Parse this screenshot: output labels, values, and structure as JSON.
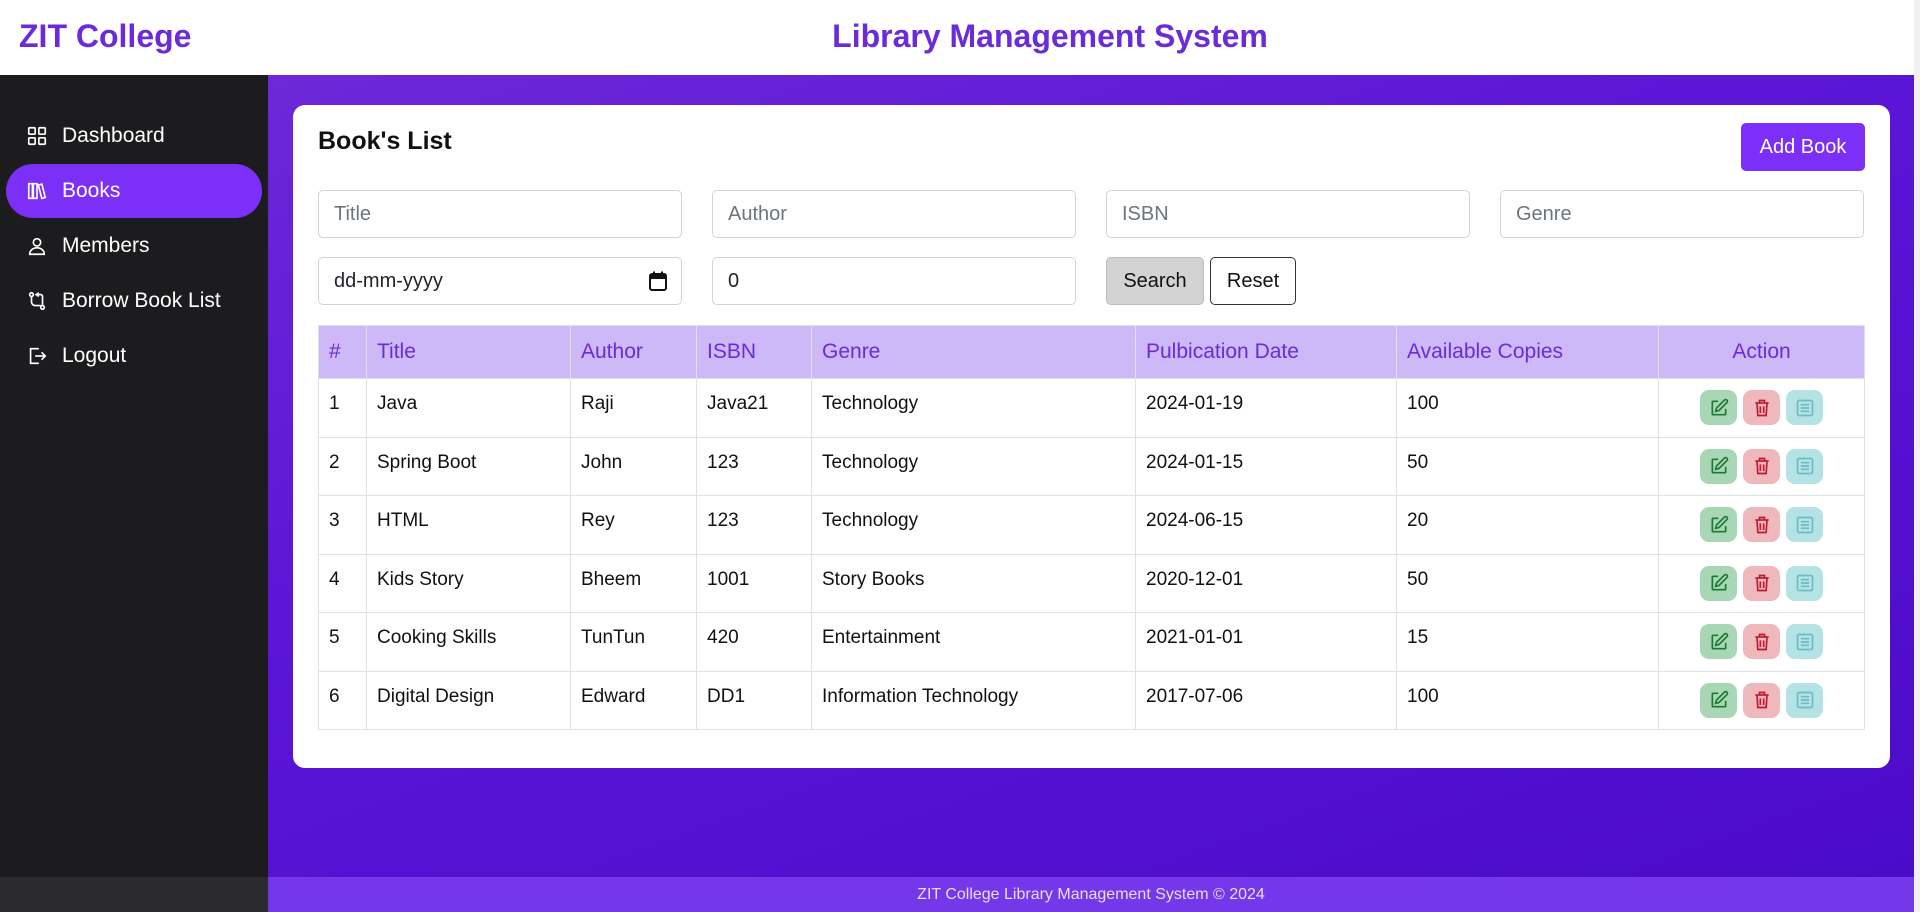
{
  "header": {
    "brand": "ZIT College",
    "title": "Library Management System"
  },
  "sidebar": {
    "items": [
      {
        "label": "Dashboard",
        "icon": "dashboard-icon",
        "active": false
      },
      {
        "label": "Books",
        "icon": "books-icon",
        "active": true
      },
      {
        "label": "Members",
        "icon": "user-icon",
        "active": false
      },
      {
        "label": "Borrow Book List",
        "icon": "borrow-icon",
        "active": false
      },
      {
        "label": "Logout",
        "icon": "logout-icon",
        "active": false
      }
    ]
  },
  "main": {
    "title": "Book's List",
    "add_button": "Add Book",
    "filters": {
      "title_placeholder": "Title",
      "author_placeholder": "Author",
      "isbn_placeholder": "ISBN",
      "genre_placeholder": "Genre",
      "date_placeholder": "dd-mm-yyyy",
      "copies_value": "0",
      "search_label": "Search",
      "reset_label": "Reset"
    },
    "table": {
      "headers": [
        "#",
        "Title",
        "Author",
        "ISBN",
        "Genre",
        "Pulbication Date",
        "Available Copies",
        "Action"
      ],
      "rows": [
        [
          "1",
          "Java",
          "Raji",
          "Java21",
          "Technology",
          "2024-01-19",
          "100"
        ],
        [
          "2",
          "Spring Boot",
          "John",
          "123",
          "Technology",
          "2024-01-15",
          "50"
        ],
        [
          "3",
          "HTML",
          "Rey",
          "123",
          "Technology",
          "2024-06-15",
          "20"
        ],
        [
          "4",
          "Kids Story",
          "Bheem",
          "1001",
          "Story Books",
          "2020-12-01",
          "50"
        ],
        [
          "5",
          "Cooking Skills",
          "TunTun",
          "420",
          "Entertainment",
          "2021-01-01",
          "15"
        ],
        [
          "6",
          "Digital Design",
          "Edward",
          "DD1",
          "Information Technology",
          "2017-07-06",
          "100"
        ]
      ]
    }
  },
  "footer": {
    "text": "ZIT College Library Management System © 2024"
  },
  "colors": {
    "accent": "#7b2ff7",
    "sidebar_bg": "#1c1c1f",
    "header_row_bg": "#cdb8f8"
  }
}
